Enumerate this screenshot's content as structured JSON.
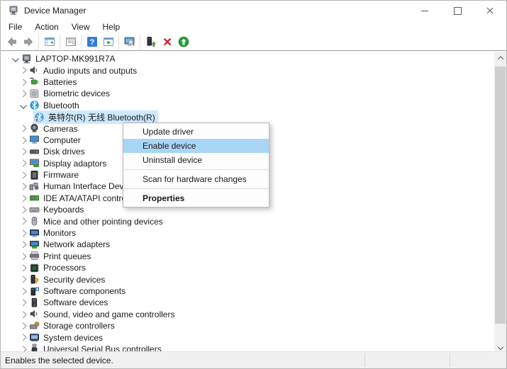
{
  "window": {
    "title": "Device Manager",
    "controls": [
      {
        "name": "minimize"
      },
      {
        "name": "maximize"
      },
      {
        "name": "close"
      }
    ]
  },
  "menu_bar": {
    "items": [
      {
        "label": "File"
      },
      {
        "label": "Action"
      },
      {
        "label": "View"
      },
      {
        "label": "Help"
      }
    ]
  },
  "toolbar": {
    "items": [
      {
        "icon": "back-arrow"
      },
      {
        "icon": "forward-arrow"
      },
      {
        "type": "separator"
      },
      {
        "icon": "show-console-tree"
      },
      {
        "type": "separator"
      },
      {
        "icon": "properties-window"
      },
      {
        "type": "separator"
      },
      {
        "icon": "help"
      },
      {
        "icon": "action-window"
      },
      {
        "type": "separator"
      },
      {
        "icon": "scan-hardware"
      },
      {
        "type": "separator"
      },
      {
        "icon": "enable-device"
      },
      {
        "icon": "uninstall-device"
      },
      {
        "icon": "update-driver"
      }
    ]
  },
  "tree": {
    "items": [
      {
        "label": "LAPTOP-MK991R7A",
        "level": 1,
        "expander": "expanded",
        "icon": "computer-root",
        "selected": false
      },
      {
        "label": "Audio inputs and outputs",
        "level": 2,
        "expander": "collapsed",
        "icon": "audio",
        "selected": false
      },
      {
        "label": "Batteries",
        "level": 2,
        "expander": "collapsed",
        "icon": "battery",
        "selected": false
      },
      {
        "label": "Biometric devices",
        "level": 2,
        "expander": "collapsed",
        "icon": "biometric",
        "selected": false
      },
      {
        "label": "Bluetooth",
        "level": 2,
        "expander": "expanded",
        "icon": "bluetooth",
        "selected": false
      },
      {
        "label": "英特尔(R) 无线 Bluetooth(R)",
        "level": 3,
        "expander": "none",
        "icon": "bluetooth-disabled",
        "selected": true
      },
      {
        "label": "Cameras",
        "level": 2,
        "expander": "collapsed",
        "icon": "camera",
        "selected": false
      },
      {
        "label": "Computer",
        "level": 2,
        "expander": "collapsed",
        "icon": "computer",
        "selected": false
      },
      {
        "label": "Disk drives",
        "level": 2,
        "expander": "collapsed",
        "icon": "disk",
        "selected": false
      },
      {
        "label": "Display adaptors",
        "level": 2,
        "expander": "collapsed",
        "icon": "display-adapter",
        "selected": false
      },
      {
        "label": "Firmware",
        "level": 2,
        "expander": "collapsed",
        "icon": "firmware",
        "selected": false
      },
      {
        "label": "Human Interface Devices",
        "level": 2,
        "expander": "collapsed",
        "icon": "hid",
        "selected": false
      },
      {
        "label": "IDE ATA/ATAPI controllers",
        "level": 2,
        "expander": "collapsed",
        "icon": "ide",
        "selected": false
      },
      {
        "label": "Keyboards",
        "level": 2,
        "expander": "collapsed",
        "icon": "keyboard",
        "selected": false
      },
      {
        "label": "Mice and other pointing devices",
        "level": 2,
        "expander": "collapsed",
        "icon": "mouse",
        "selected": false
      },
      {
        "label": "Monitors",
        "level": 2,
        "expander": "collapsed",
        "icon": "monitor",
        "selected": false
      },
      {
        "label": "Network adapters",
        "level": 2,
        "expander": "collapsed",
        "icon": "network",
        "selected": false
      },
      {
        "label": "Print queues",
        "level": 2,
        "expander": "collapsed",
        "icon": "printer",
        "selected": false
      },
      {
        "label": "Processors",
        "level": 2,
        "expander": "collapsed",
        "icon": "processor",
        "selected": false
      },
      {
        "label": "Security devices",
        "level": 2,
        "expander": "collapsed",
        "icon": "security",
        "selected": false
      },
      {
        "label": "Software components",
        "level": 2,
        "expander": "collapsed",
        "icon": "software-component",
        "selected": false
      },
      {
        "label": "Software devices",
        "level": 2,
        "expander": "collapsed",
        "icon": "software-device",
        "selected": false
      },
      {
        "label": "Sound, video and game controllers",
        "level": 2,
        "expander": "collapsed",
        "icon": "sound",
        "selected": false
      },
      {
        "label": "Storage controllers",
        "level": 2,
        "expander": "collapsed",
        "icon": "storage",
        "selected": false
      },
      {
        "label": "System devices",
        "level": 2,
        "expander": "collapsed",
        "icon": "system",
        "selected": false
      },
      {
        "label": "Universal Serial Bus controllers",
        "level": 2,
        "expander": "collapsed",
        "icon": "usb",
        "selected": false
      }
    ]
  },
  "context_menu": {
    "items": [
      {
        "label": "Update driver"
      },
      {
        "label": "Enable device",
        "highlighted": true
      },
      {
        "label": "Uninstall device"
      },
      {
        "type": "separator"
      },
      {
        "label": "Scan for hardware changes"
      },
      {
        "type": "separator"
      },
      {
        "label": "Properties",
        "bold": true
      }
    ]
  },
  "status_bar": {
    "text": "Enables the selected device."
  },
  "colors": {
    "tree_selection": "#cde8ff",
    "menu_highlight": "#a9d6f5",
    "bluetooth_blue": "#1f97e0",
    "uninstall_red": "#d21f24",
    "update_green": "#23a33a"
  }
}
